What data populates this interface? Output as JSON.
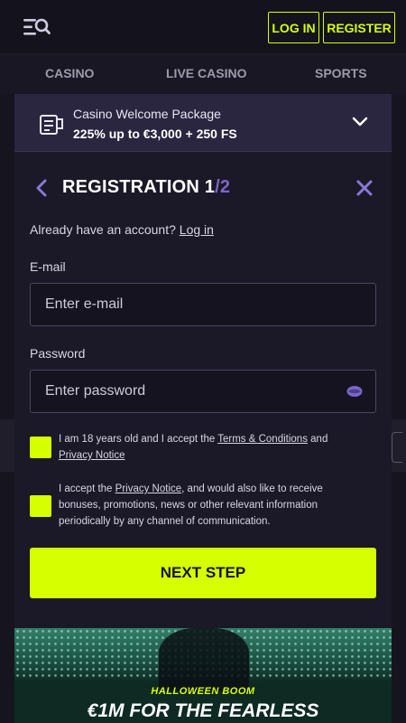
{
  "header": {
    "login_label": "LOG IN",
    "register_label": "REGISTER"
  },
  "nav": {
    "tabs": [
      "CASINO",
      "LIVE CASINO",
      "SPORTS"
    ]
  },
  "promo": {
    "title": "Casino Welcome Package",
    "subtitle": "225% up to €3,000 + 250 FS"
  },
  "registration": {
    "title": "REGISTRATION",
    "step_current": "1",
    "step_separator": "/",
    "step_total": "2",
    "have_account_text": "Already have an account?",
    "login_link": "Log in",
    "email_label": "E-mail",
    "email_placeholder": "Enter e-mail",
    "password_label": "Password",
    "password_placeholder": "Enter password",
    "checkbox1": {
      "text_before": "I am 18 years old and I accept the ",
      "link1": "Terms & Conditions",
      "text_middle": " and ",
      "link2": "Privacy Notice"
    },
    "checkbox2": {
      "text_before": "I accept the ",
      "link": "Privacy Notice",
      "text_after": ", and would also like to receive bonuses, promotions, news or other relevant information periodically by any channel of communication."
    },
    "next_label": "NEXT STEP"
  },
  "banner": {
    "tag": "HALLOWEEN BOOM",
    "title": "€1M FOR THE FEARLESS"
  },
  "colors": {
    "accent": "#d6ff00",
    "background": "#16141f",
    "panel": "#1b1927",
    "promo_bg": "#2a2640",
    "step_total": "#7c67c9"
  },
  "icons": {
    "menu": "menu-search-icon",
    "promo": "gift-card-icon",
    "expand": "chevron-down-icon",
    "back": "chevron-left-icon",
    "close": "close-icon",
    "password_toggle": "eye-icon"
  }
}
